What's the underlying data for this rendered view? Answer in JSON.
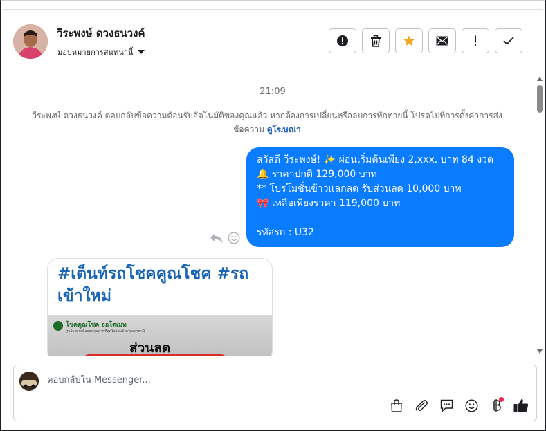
{
  "header": {
    "contact_name": "วีระพงษ์ ดวงธนวงค์",
    "assign_label": "มอบหมายการสนทนานี้",
    "actions": [
      {
        "icon": "exclamation-circle-icon"
      },
      {
        "icon": "trash-icon"
      },
      {
        "icon": "star-icon",
        "color": "#f5a623"
      },
      {
        "icon": "envelope-icon"
      },
      {
        "icon": "exclamation-icon"
      },
      {
        "icon": "check-icon"
      }
    ]
  },
  "chat": {
    "timestamp": "21:09",
    "notice_text": "วีระพงษ์ ดวงธนวงค์ ตอบกลับข้อความต้อนรับอัตโนมัติของคุณแล้ว หากต้องการเปลี่ยนหรือลบการทักทายนี้ โปรดไปที่การตั้งค่าการส่งข้อความ",
    "notice_link": "ดูโฆษณา",
    "bubble_color": "#0a7cff",
    "bubble_lines": [
      "สวัสดี วีระพงษ์! ✨  ผ่อนเริ่มต้นเพียง 2,xxx. บาท 84 งวด",
      "🔔 ราคาปกติ 129,000 บาท",
      "** โปรโมชั่นข้าวแลกลด รับส่วนลด 10,000 บาท",
      "🎀  เหลือเพียงราคา 119,000 บาท",
      "",
      " รหัสรถ : U32"
    ],
    "card_title": "#เต็นท์รถโชคคูณโชค #รถเข้าใหม่",
    "card_image": {
      "brand": "โชคคูณโชค ออโตเมท",
      "brand_sub": "ศูนย์รวมรถมือสองคุณภาพที่สุดในโซนจังหวัดอุดรธานี",
      "discount": "ส่วนลด"
    }
  },
  "composer": {
    "placeholder": "ตอบกลับใน Messenger...",
    "tools": [
      "shopping-bag-icon",
      "paperclip-icon",
      "chat-bubble-icon",
      "smiley-icon",
      "baht-icon",
      "thumbs-up-icon"
    ]
  }
}
